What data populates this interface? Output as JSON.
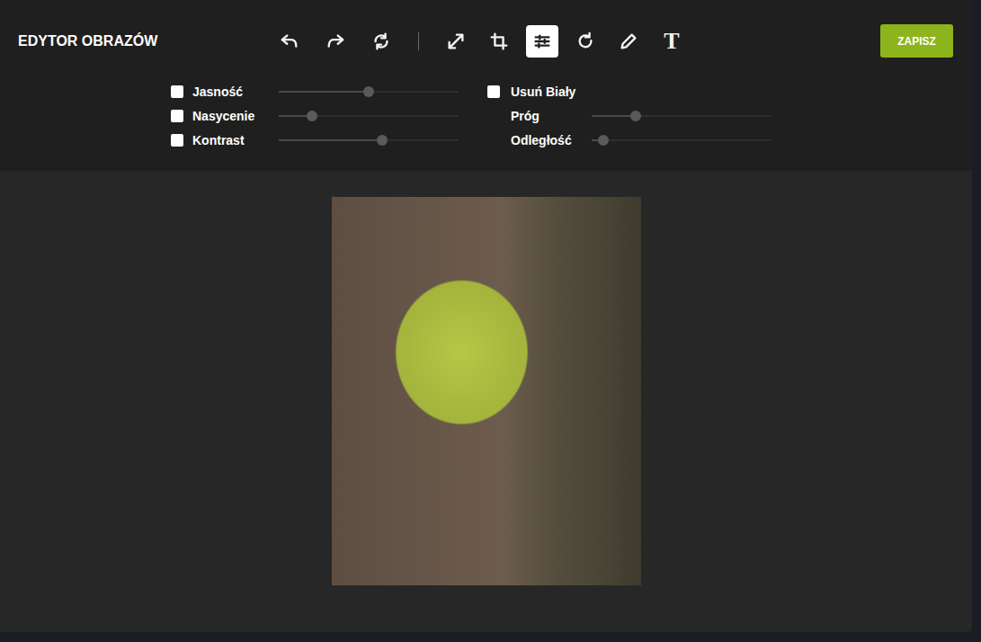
{
  "window": {
    "title": "EDYTOR OBRAZÓW"
  },
  "toolbar": {
    "tools": [
      {
        "selected": false
      },
      {
        "selected": false
      },
      {
        "selected": false
      },
      {
        "selected": false
      },
      {
        "selected": false
      },
      {
        "selected": true
      },
      {
        "selected": false
      },
      {
        "selected": false
      },
      {
        "glyph": "T",
        "selected": false
      }
    ]
  },
  "save_button": {
    "label": "ZAPISZ"
  },
  "adjustments": {
    "left": [
      {
        "label": "Jasność",
        "kind": "checkbox-slider",
        "checked": false,
        "level": 0.5
      },
      {
        "label": "Nasycenie",
        "kind": "checkbox-slider",
        "checked": false,
        "level": 0.185
      },
      {
        "label": "Kontrast",
        "kind": "checkbox-slider",
        "checked": false,
        "level": 0.575
      }
    ],
    "right": [
      {
        "label": "Usuń Biały",
        "kind": "checkbox",
        "checked": false
      },
      {
        "label": "Próg",
        "kind": "slider",
        "level": 0.245
      },
      {
        "label": "Odległość",
        "kind": "slider",
        "level": 0.065
      }
    ]
  }
}
